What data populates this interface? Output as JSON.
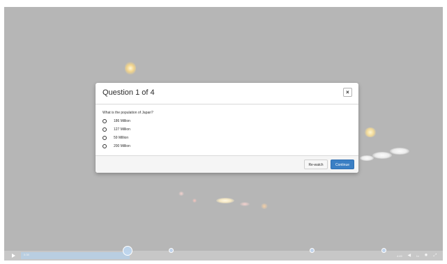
{
  "player": {
    "time": "0:38",
    "duration_display": "4:45",
    "speed": "1x",
    "progress_fraction": 0.27
  },
  "quiz": {
    "title": "Question 1 of 4",
    "question": "What is the population of Japan?",
    "options": [
      "186 Million",
      "127 Million",
      "59 Million",
      "200 Million"
    ],
    "buttons": {
      "rewatch": "Re-watch",
      "continue": "Continue"
    }
  },
  "colors": {
    "accent": "#3b7fc4"
  },
  "icons": {
    "close": "close-icon",
    "play": "play-icon",
    "volume": "volume-icon",
    "settings": "gear-icon",
    "fullscreen": "fullscreen-icon"
  }
}
